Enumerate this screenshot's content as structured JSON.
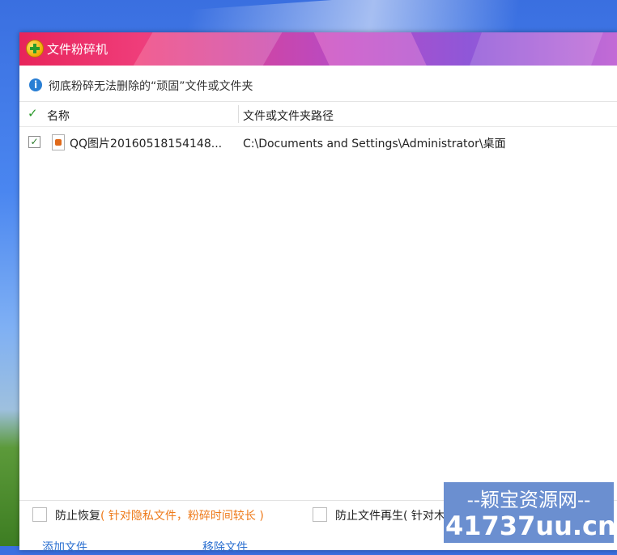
{
  "window": {
    "title": "文件粉碎机"
  },
  "info": {
    "text": "彻底粉碎无法删除的“顽固”文件或文件夹",
    "icon": "info-icon"
  },
  "list": {
    "columns": [
      "名称",
      "文件或文件夹路径"
    ],
    "rows": [
      {
        "checked": true,
        "name": "QQ图片20160518154148...",
        "path": "C:\\Documents and Settings\\Administrator\\桌面"
      }
    ]
  },
  "options": {
    "prevent_recovery_label": "防止恢复",
    "prevent_recovery_note": "( 针对隐私文件，粉碎时间较长 )",
    "prevent_regen_label": "防止文件再生",
    "prevent_regen_note": "( 针对木马"
  },
  "footer": {
    "add_label": "添加文件",
    "remove_label": "移除文件"
  },
  "watermark": {
    "top": "--颖宝资源网--",
    "bottom": "41737uu.cn"
  },
  "colors": {
    "accent_green": "#2a9a2a",
    "note_orange": "#ee7a1a",
    "info_blue": "#2a7fd4"
  }
}
